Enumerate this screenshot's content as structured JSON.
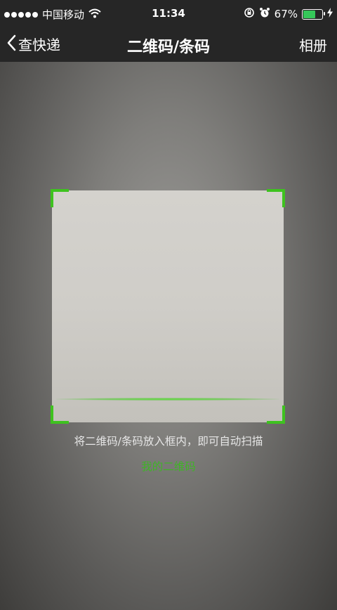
{
  "status_bar": {
    "carrier": "中国移动",
    "time": "11:34",
    "battery_percent": "67%",
    "battery_level": 0.67
  },
  "nav": {
    "back_label": "查快递",
    "title": "二维码/条码",
    "album_label": "相册"
  },
  "scanner": {
    "hint": "将二维码/条码放入框内，即可自动扫描",
    "my_qr_label": "我的二维码"
  },
  "colors": {
    "accent": "#3ec21f",
    "nav_background": "#262626"
  }
}
